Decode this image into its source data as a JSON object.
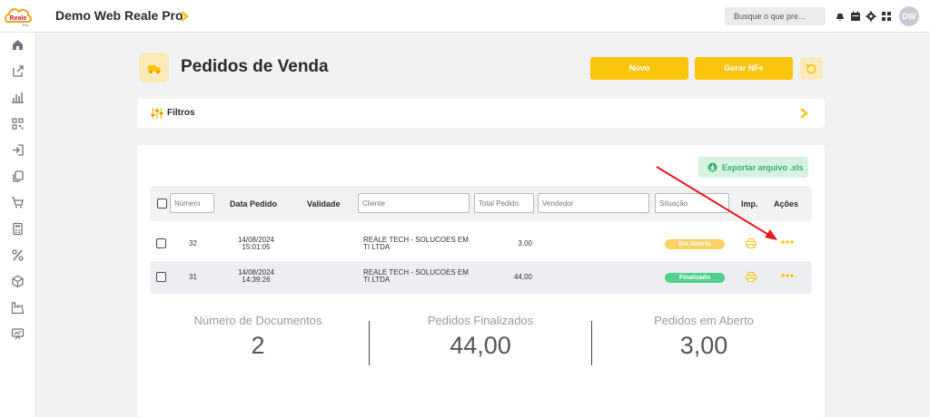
{
  "topbar": {
    "logo_text": "Reale Pro",
    "app_title": "Demo Web Reale Pro",
    "search_placeholder": "Busque o que pre...",
    "avatar_initials": "DW",
    "icons": [
      "bell-icon",
      "calendar-icon",
      "gear-icon",
      "apps-grid-icon"
    ]
  },
  "sidebar": {
    "icons": [
      "home-icon",
      "export-icon",
      "chart-icon",
      "qrcode-icon",
      "login-icon",
      "copy-icon",
      "cart-icon",
      "calculator-icon",
      "percent-icon",
      "box-icon",
      "factory-icon",
      "presentation-icon"
    ]
  },
  "header": {
    "title": "Pedidos de Venda",
    "new_label": "Novo",
    "nfe_label": "Gerar NFe"
  },
  "filters": {
    "label": "Filtros"
  },
  "export": {
    "label": "Exportar arquivo .xls"
  },
  "table": {
    "placeholders": {
      "numero": "Número",
      "cliente": "Cliente",
      "total": "Total Pedido",
      "vendedor": "Vendedor",
      "situacao": "Situação"
    },
    "headers": {
      "data": "Data Pedido",
      "validade": "Validade",
      "imp": "Imp.",
      "acoes": "Ações"
    },
    "rows": [
      {
        "numero": "32",
        "date": "14/08/2024",
        "time": "15:01:05",
        "cliente1": "REALE TECH - SOLUCOES EM",
        "cliente2": "TI LTDA",
        "total": "3,00",
        "status": "Em Aberto",
        "status_color": "#fbd263"
      },
      {
        "numero": "31",
        "date": "14/08/2024",
        "time": "14:39:26",
        "cliente1": "REALE TECH - SOLUCOES EM",
        "cliente2": "TI LTDA",
        "total": "44,00",
        "status": "Finalizado",
        "status_color": "#4fd08b"
      }
    ]
  },
  "summary": {
    "docs_label": "Número de Documentos",
    "docs_value": "2",
    "finalizados_label": "Pedidos Finalizados",
    "finalizados_value": "44,00",
    "aberto_label": "Pedidos em Aberto",
    "aberto_value": "3,00"
  },
  "colors": {
    "accent": "#fbc40c",
    "annotation_arrow": "#e8191d"
  }
}
